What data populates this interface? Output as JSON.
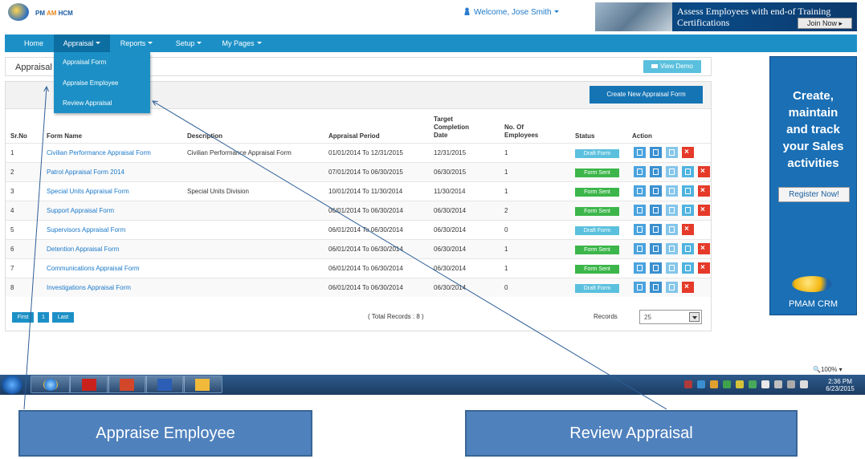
{
  "header": {
    "logo_text_a": "PM",
    "logo_text_b": "AM",
    "logo_text_c": "HCM",
    "welcome": "Welcome, Jose Smith",
    "banner_text": "Assess Employees with end-of Training Certifications",
    "banner_button": "Join Now ▸"
  },
  "nav": {
    "items": [
      {
        "label": "Home"
      },
      {
        "label": "Appraisal"
      },
      {
        "label": "Reports"
      },
      {
        "label": "Setup"
      },
      {
        "label": "My Pages"
      }
    ]
  },
  "dropdown": {
    "items": [
      {
        "label": "Appraisal Form"
      },
      {
        "label": "Appraise Employee"
      },
      {
        "label": "Review Appraisal"
      }
    ]
  },
  "page": {
    "title": "Appraisal",
    "view_demo": "View Demo",
    "create_button": "Create New Appraisal Form"
  },
  "table": {
    "headers": {
      "srno": "Sr.No",
      "form_name": "Form Name",
      "description": "Description",
      "period": "Appraisal Period",
      "target_1": "Target",
      "target_2": "Completion",
      "target_3": "Date",
      "employees_1": "No. Of",
      "employees_2": "Employees",
      "status": "Status",
      "action": "Action"
    },
    "rows": [
      {
        "srno": "1",
        "name": "Civilian Performance Appraisal Form",
        "description": "Civilian Performance Appraisal Form",
        "period": "01/01/2014 To 12/31/2015",
        "target": "12/31/2015",
        "employees": "1",
        "status": "Draft Form"
      },
      {
        "srno": "2",
        "name": "Patrol Appraisal Form 2014",
        "description": "",
        "period": "07/01/2014 To 06/30/2015",
        "target": "06/30/2015",
        "employees": "1",
        "status": "Form Sent"
      },
      {
        "srno": "3",
        "name": "Special Units Appraisal Form",
        "description": "Special Units Division",
        "period": "10/01/2014 To 11/30/2014",
        "target": "11/30/2014",
        "employees": "1",
        "status": "Form Sent"
      },
      {
        "srno": "4",
        "name": "Support Appraisal Form",
        "description": "",
        "period": "06/01/2014 To 06/30/2014",
        "target": "06/30/2014",
        "employees": "2",
        "status": "Form Sent"
      },
      {
        "srno": "5",
        "name": "Supervisors Appraisal Form",
        "description": "",
        "period": "06/01/2014 To 06/30/2014",
        "target": "06/30/2014",
        "employees": "0",
        "status": "Draft Form"
      },
      {
        "srno": "6",
        "name": "Detention Appraisal Form",
        "description": "",
        "period": "06/01/2014 To 06/30/2014",
        "target": "06/30/2014",
        "employees": "1",
        "status": "Form Sent"
      },
      {
        "srno": "7",
        "name": "Communications Appraisal Form",
        "description": "",
        "period": "06/01/2014 To 06/30/2014",
        "target": "06/30/2014",
        "employees": "1",
        "status": "Form Sent"
      },
      {
        "srno": "8",
        "name": "Investigations Appraisal Form",
        "description": "",
        "period": "06/01/2014 To 06/30/2014",
        "target": "06/30/2014",
        "employees": "0",
        "status": "Draft Form"
      }
    ]
  },
  "pagination": {
    "first": "First",
    "page": "1",
    "last": "Last",
    "total": "( Total Records : 8 )",
    "records_label": "Records",
    "records_value": "25"
  },
  "side_banner": {
    "line1": "Create,",
    "line2": "maintain",
    "line3": "and track",
    "line4": "your Sales",
    "line5": "activities",
    "button": "Register Now!",
    "brand": "PMAM CRM"
  },
  "status_bar": {
    "zoom": "🔍100% ▾"
  },
  "taskbar": {
    "time": "2:36 PM",
    "date": "6/23/2015"
  },
  "callouts": {
    "left": "Appraise Employee",
    "right": "Review Appraisal"
  },
  "colors": {
    "nav": "#1c90c6",
    "draft": "#5bc0de",
    "sent": "#3cb64a",
    "delete": "#e53a2a",
    "callout": "#4f81bd"
  }
}
